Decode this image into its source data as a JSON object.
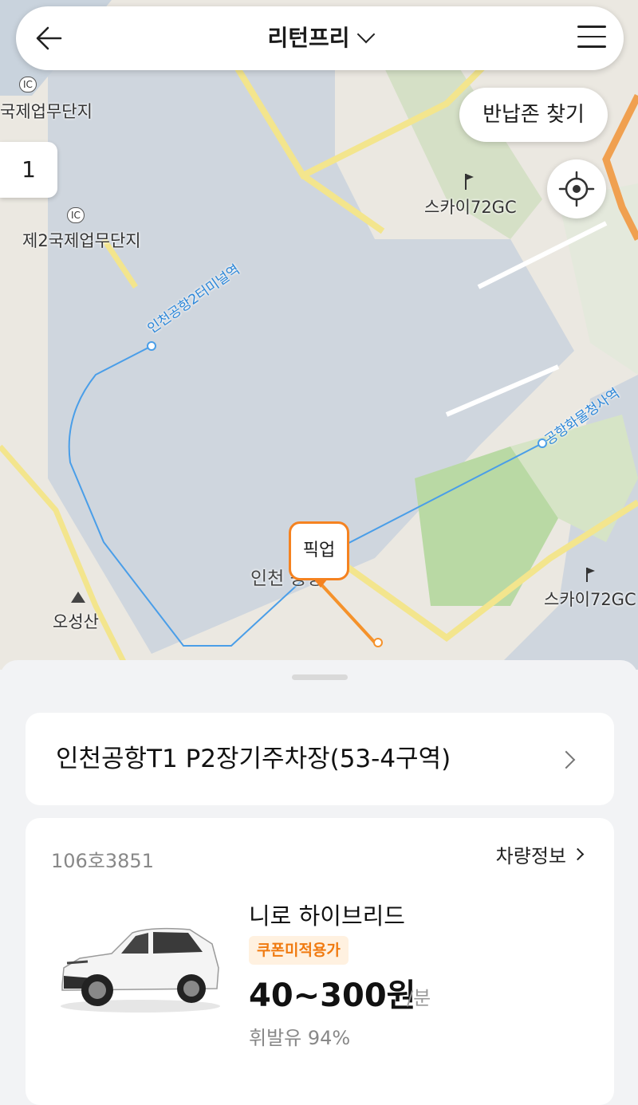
{
  "header": {
    "title": "리턴프리"
  },
  "map": {
    "return_zone_button": "반납존 찾기",
    "cluster_count": "1",
    "pickup_label": "픽업",
    "labels": {
      "industrial1": "국제업무단지",
      "industrial2": "제2국제업무단지",
      "t2_station": "인천공항2터미널역",
      "cargo_station": "공항화물청사역",
      "golf1": "스카이72GC",
      "golf2": "스카이72GC",
      "airport": "인천  공항",
      "mountain": "오성산",
      "ic": "IC"
    }
  },
  "location": {
    "name": "인천공항T1 P2장기주차장(53-4구역)"
  },
  "car": {
    "plate": "106호3851",
    "info_link": "차량정보",
    "model": "니로 하이브리드",
    "badge": "쿠폰미적용가",
    "price": "40~300원",
    "unit": "/분",
    "fuel": "휘발유 94%"
  }
}
